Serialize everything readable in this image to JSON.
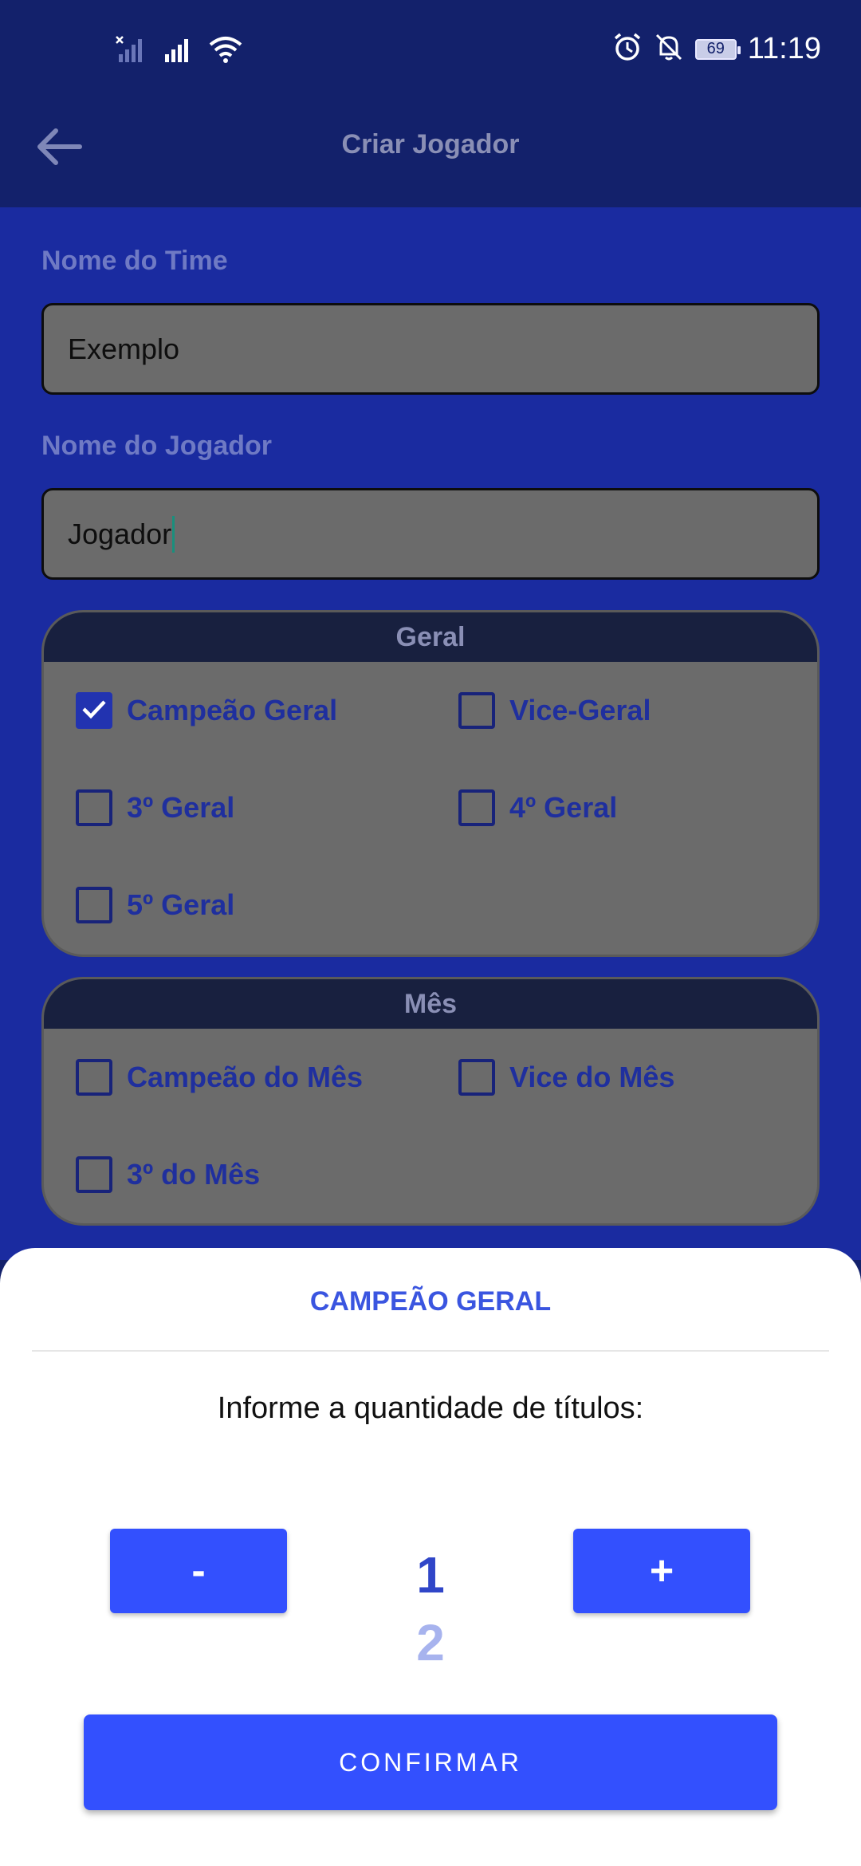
{
  "status_bar": {
    "time": "11:19",
    "battery": "69",
    "icons": [
      "no-sim-signal-icon",
      "signal-icon",
      "wifi-icon",
      "alarm-icon",
      "mute-bell-icon",
      "battery-icon"
    ]
  },
  "app_bar": {
    "title": "Criar Jogador",
    "back_icon": "arrow-left-icon"
  },
  "form": {
    "team_label": "Nome do Time",
    "team_value": "Exemplo",
    "player_label": "Nome do Jogador",
    "player_value": "Jogador"
  },
  "sections": [
    {
      "title": "Geral",
      "options": [
        {
          "label": "Campeão Geral",
          "checked": true
        },
        {
          "label": "Vice-Geral",
          "checked": false
        },
        {
          "label": "3º Geral",
          "checked": false
        },
        {
          "label": "4º Geral",
          "checked": false
        },
        {
          "label": "5º Geral",
          "checked": false
        }
      ]
    },
    {
      "title": "Mês",
      "options": [
        {
          "label": "Campeão do Mês",
          "checked": false
        },
        {
          "label": "Vice do Mês",
          "checked": false
        },
        {
          "label": "3º do Mês",
          "checked": false
        }
      ]
    }
  ],
  "sheet": {
    "title": "CAMPEÃO GERAL",
    "prompt": "Informe a quantidade de títulos:",
    "minus_label": "-",
    "plus_label": "+",
    "current_value": "1",
    "next_value": "2",
    "confirm_label": "CONFIRMAR"
  },
  "colors": {
    "background": "#13216b",
    "content": "#1a2ba0",
    "accent": "#3350fe",
    "card": "#6b6b6b"
  }
}
